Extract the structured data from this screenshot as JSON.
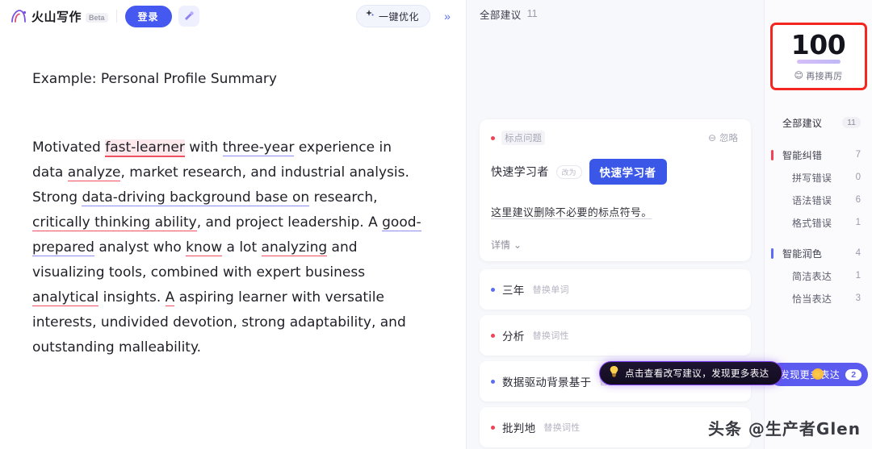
{
  "header": {
    "brand_name": "火山写作",
    "beta_label": "Beta",
    "login_label": "登录",
    "wand_icon": "magic-wand-icon",
    "optimize_label": "一键优化",
    "optimize_icon": "sparkle-icon",
    "collapse_icon": "double-chevron-right-icon"
  },
  "document": {
    "title": "Example: Personal Profile Summary",
    "paragraph": {
      "p1": "Motivated ",
      "s1": "fast-learner",
      "p2": " with ",
      "s2": "three-year",
      "p3": " experience in data ",
      "s3": "analyze",
      "p4": ", market research, and industrial analysis. Strong ",
      "s4": "data-driving background base on",
      "p5": " research, ",
      "s5": "critically thinking ability",
      "p6": ", and project leadership. A ",
      "s6": "good-prepared",
      "p7": " analyst who ",
      "s7": "know",
      "p8": " a lot ",
      "s8": "analyzing",
      "p9": " and visualizing tools, combined with expert business ",
      "s9": "analytical",
      "p10": " insights. ",
      "s10": "A",
      "p11": " aspiring learner with versatile interests, undivided devotion, strong adaptability, and outstanding malleability."
    }
  },
  "suggestions": {
    "header_label": "全部建议",
    "header_count": "11",
    "card": {
      "tag": "标点问题",
      "tag_dot": "red",
      "ignore_label": "忽略",
      "ignore_icon": "minus-circle-icon",
      "old_text": "快速学习者",
      "arrow_label": "改为",
      "new_text": "快速学习者",
      "description": "这里建议删除不必要的标点符号。",
      "more_label": "详情",
      "more_icon": "chevron-down-icon"
    },
    "list": [
      {
        "dot": "blue",
        "word": "三年",
        "action": "替换单词"
      },
      {
        "dot": "red",
        "word": "分析",
        "action": "替换词性"
      },
      {
        "dot": "blue",
        "word": "数据驱动背景基于",
        "action": "替换"
      },
      {
        "dot": "red",
        "word": "批判地",
        "action": "替换词性"
      }
    ],
    "tooltip": {
      "icon": "lightbulb-icon",
      "text": "点击查看改写建议，发现更多表达"
    }
  },
  "score_panel": {
    "score": "100",
    "score_emoji": "😊",
    "score_caption": "再接再厉",
    "categories": [
      {
        "name": "全部建议",
        "count": "11",
        "bar": "none",
        "level": "all"
      },
      {
        "name": "智能纠错",
        "count": "7",
        "bar": "red",
        "level": "top"
      },
      {
        "name": "拼写错误",
        "count": "0",
        "bar": "none",
        "level": "sub"
      },
      {
        "name": "语法错误",
        "count": "6",
        "bar": "none",
        "level": "sub"
      },
      {
        "name": "格式错误",
        "count": "1",
        "bar": "none",
        "level": "sub"
      },
      {
        "name": "智能润色",
        "count": "4",
        "bar": "blue",
        "level": "top"
      },
      {
        "name": "简洁表达",
        "count": "1",
        "bar": "none",
        "level": "sub"
      },
      {
        "name": "恰当表达",
        "count": "3",
        "bar": "none",
        "level": "sub"
      }
    ],
    "discover_label": "发现更多表达",
    "discover_badge": "2"
  },
  "watermark": "头条 @生产者Glen",
  "colors": {
    "primary": "#4558f0",
    "error_red": "#ef4356",
    "polish_blue": "#5b6cf5",
    "score_border": "#f5261f",
    "tooltip_border": "#7d3df0"
  }
}
